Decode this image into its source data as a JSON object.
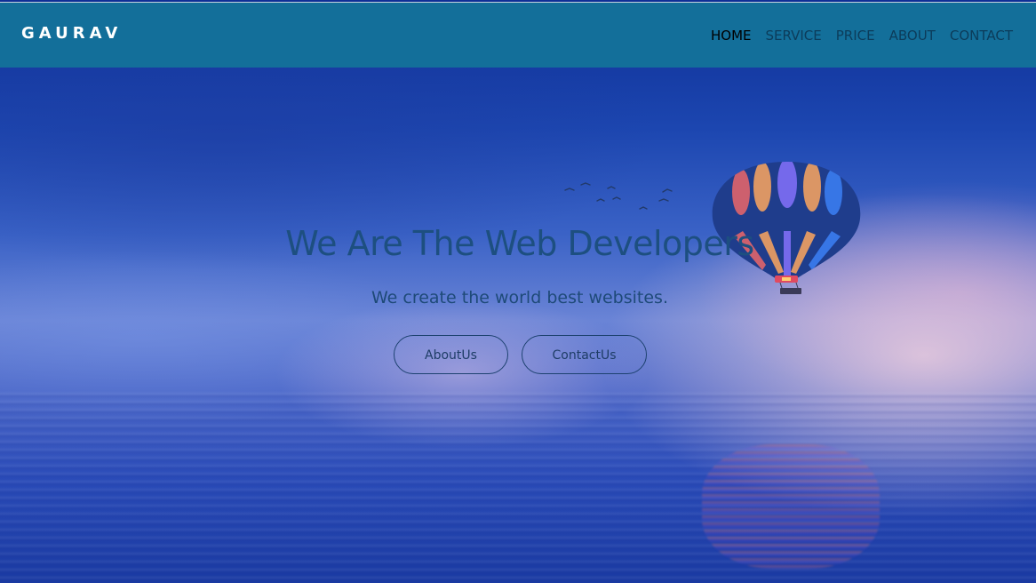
{
  "brand": {
    "name": "GAURAV"
  },
  "nav": {
    "items": [
      {
        "label": "HOME",
        "active": true
      },
      {
        "label": "SERVICE",
        "active": false
      },
      {
        "label": "PRICE",
        "active": false
      },
      {
        "label": "ABOUT",
        "active": false
      },
      {
        "label": "CONTACT",
        "active": false
      }
    ]
  },
  "hero": {
    "title": "We Are The Web Developers",
    "subtitle": "We create the world best websites.",
    "buttons": {
      "about": "AboutUs",
      "contact": "ContactUs"
    }
  },
  "colors": {
    "navbar": "#136f9a",
    "brand_text": "#ffffff",
    "nav_active": "#000000",
    "nav_text": "#0c3c5a",
    "hero_title": "#1d4f80",
    "button_border": "#1d4270"
  }
}
